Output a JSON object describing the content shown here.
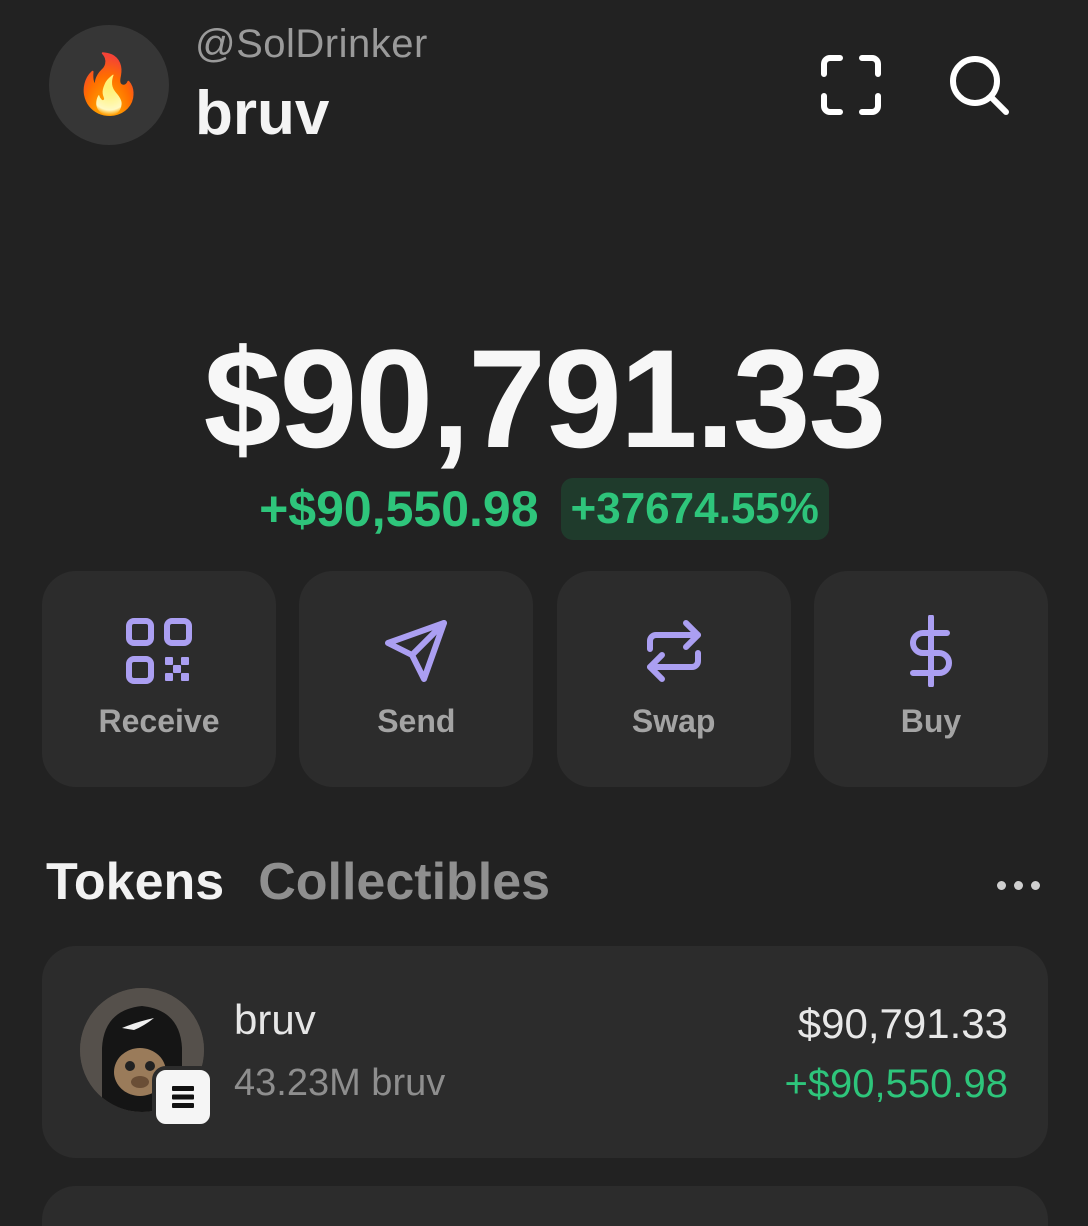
{
  "header": {
    "avatar_icon": "fire-emoji",
    "avatar_emoji": "🔥",
    "handle": "@SolDrinker",
    "account_name": "bruv",
    "scan_icon": "scan-icon",
    "search_icon": "search-icon"
  },
  "portfolio": {
    "balance": "$90,791.33",
    "change_amount": "+$90,550.98",
    "change_percent": "+37674.55%"
  },
  "actions": [
    {
      "label": "Receive",
      "icon": "qr-code-icon"
    },
    {
      "label": "Send",
      "icon": "send-icon"
    },
    {
      "label": "Swap",
      "icon": "swap-icon"
    },
    {
      "label": "Buy",
      "icon": "dollar-icon"
    }
  ],
  "tabs": {
    "tokens": "Tokens",
    "collectibles": "Collectibles",
    "more_icon": "more-icon"
  },
  "tokens": [
    {
      "name": "bruv",
      "quantity": "43.23M bruv",
      "value": "$90,791.33",
      "change": "+$90,550.98",
      "chain_icon": "solana-icon"
    }
  ],
  "colors": {
    "background": "#222222",
    "card": "#2c2c2c",
    "accent": "#ab9ff2",
    "positive": "#2ec57b"
  }
}
